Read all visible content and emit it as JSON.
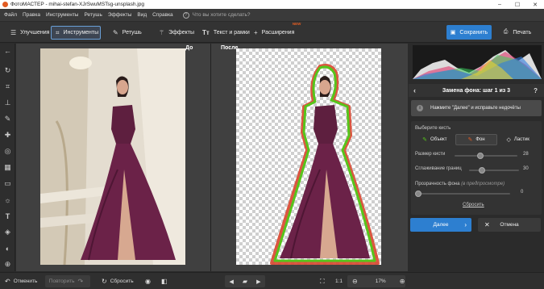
{
  "window": {
    "title": "ФотоМАСТЕР - mihai-stefan-XJrSwuMSTsg-unsplash.jpg"
  },
  "menu": {
    "items": [
      "Файл",
      "Правка",
      "Инструменты",
      "Ретушь",
      "Эффекты",
      "Вид",
      "Справка"
    ],
    "help_placeholder": "Что вы хотите сделать?"
  },
  "toolbar": {
    "tabs": [
      {
        "label": "Улучшения",
        "icon": "sliders-icon"
      },
      {
        "label": "Инструменты",
        "icon": "crop-icon"
      },
      {
        "label": "Ретушь",
        "icon": "brush-icon"
      },
      {
        "label": "Эффекты",
        "icon": "magic-wand-icon"
      },
      {
        "label": "Текст и рамки",
        "icon": "text-icon"
      },
      {
        "label": "Расширения",
        "icon": "plus-icon",
        "badge": "NEW"
      }
    ],
    "save_label": "Сохранить",
    "print_label": "Печать"
  },
  "canvas": {
    "before_label": "До",
    "after_label": "После"
  },
  "panel": {
    "step_title": "Замена фона: шаг 1 из 3",
    "hint": "Нажмите \"Далее\" и исправьте недочёты",
    "brush_label": "Выберите кисть",
    "brushes": [
      "Объект",
      "Фон",
      "Ластик"
    ],
    "brush_size_label": "Размер кисти",
    "brush_size_value": "28",
    "smoothing_label": "Сглаживание границ",
    "smoothing_value": "30",
    "opacity_label": "Прозрачность фона",
    "opacity_note": "(в предпросмотре)",
    "opacity_value": "0",
    "reset_label": "Сбросить",
    "next_label": "Далее",
    "cancel_label": "Отмена"
  },
  "bottom": {
    "undo_label": "Отменить",
    "redo_label": "Повторить",
    "reset_label": "Сбросить",
    "zoom_ratio": "1:1",
    "zoom_value": "17%"
  },
  "colors": {
    "accent": "#2d7fd0",
    "badge": "#e35d22",
    "outline_green": "#57c41c",
    "outline_red": "#d9462f"
  }
}
